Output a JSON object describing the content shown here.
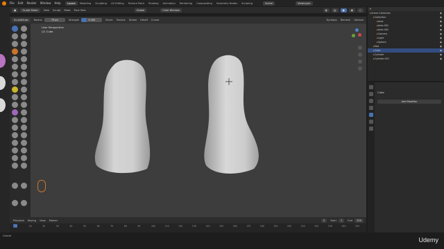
{
  "menubar": {
    "items": [
      "File",
      "Edit",
      "Render",
      "Window",
      "Help"
    ],
    "workspaces": [
      "Layout",
      "Modeling",
      "Sculpting",
      "UV Editing",
      "Texture Paint",
      "Shading",
      "Animation",
      "Rendering",
      "Compositing",
      "Geometry Nodes",
      "Scripting"
    ],
    "active_workspace": "Layout",
    "scene": "Scene",
    "view_layer": "ViewLayer"
  },
  "viewport_header": {
    "mode": "Sculpt Mode",
    "menus": [
      "View",
      "Sculpt",
      "Mask",
      "Face Sets"
    ],
    "shading": "Global",
    "color_window": "Color Window"
  },
  "tool_header": {
    "brush": "SculptDraw",
    "radius_label": "Radius",
    "radius_value": "75 px",
    "strength_label": "Strength",
    "strength_value": "0.165",
    "menus": [
      "Brush",
      "Texture",
      "Stroke",
      "Falloff",
      "Cursor"
    ],
    "right": [
      "Dyntopo",
      "Remesh",
      "Options"
    ]
  },
  "viewport": {
    "view_name": "User Perspective",
    "object_name": "(2) Cube"
  },
  "outliner": {
    "title": "Scene Collection",
    "rows": [
      {
        "label": "Scene Collection",
        "indent": 0,
        "selected": false
      },
      {
        "label": "Collection",
        "indent": 1,
        "selected": false
      },
      {
        "label": "Area",
        "indent": 2,
        "selected": false
      },
      {
        "label": "Area.001",
        "indent": 2,
        "selected": false
      },
      {
        "label": "Area.002",
        "indent": 2,
        "selected": false
      },
      {
        "label": "Camera",
        "indent": 2,
        "selected": false
      },
      {
        "label": "Light",
        "indent": 2,
        "selected": false
      },
      {
        "label": "Sphere",
        "indent": 2,
        "selected": false
      },
      {
        "label": "Mat",
        "indent": 1,
        "selected": false
      },
      {
        "label": "Cube",
        "indent": 1,
        "selected": true
      },
      {
        "label": "Cylinder",
        "indent": 1,
        "selected": false
      },
      {
        "label": "Cylinder.001",
        "indent": 1,
        "selected": false
      }
    ]
  },
  "properties": {
    "object_name": "Cube",
    "add_modifier": "Add Modifier"
  },
  "timeline": {
    "menus": [
      "Playback",
      "Keying",
      "View",
      "Marker"
    ],
    "current_frame": "2",
    "start_label": "Start",
    "start_value": "1",
    "end_label": "End",
    "end_value": "250",
    "ticks": [
      "0",
      "10",
      "20",
      "30",
      "40",
      "50",
      "60",
      "70",
      "80",
      "90",
      "100",
      "110",
      "120",
      "130",
      "140",
      "150",
      "160",
      "170",
      "180",
      "190",
      "200",
      "210",
      "220",
      "230",
      "240",
      "250"
    ]
  },
  "status": {
    "left": "Cancel",
    "watermark": "Udemy"
  },
  "colors": {
    "accent": "#4772b3",
    "viewport_bg": "#3d3d3d",
    "mesh": "#cfcfcf",
    "selection": "#334d80"
  }
}
